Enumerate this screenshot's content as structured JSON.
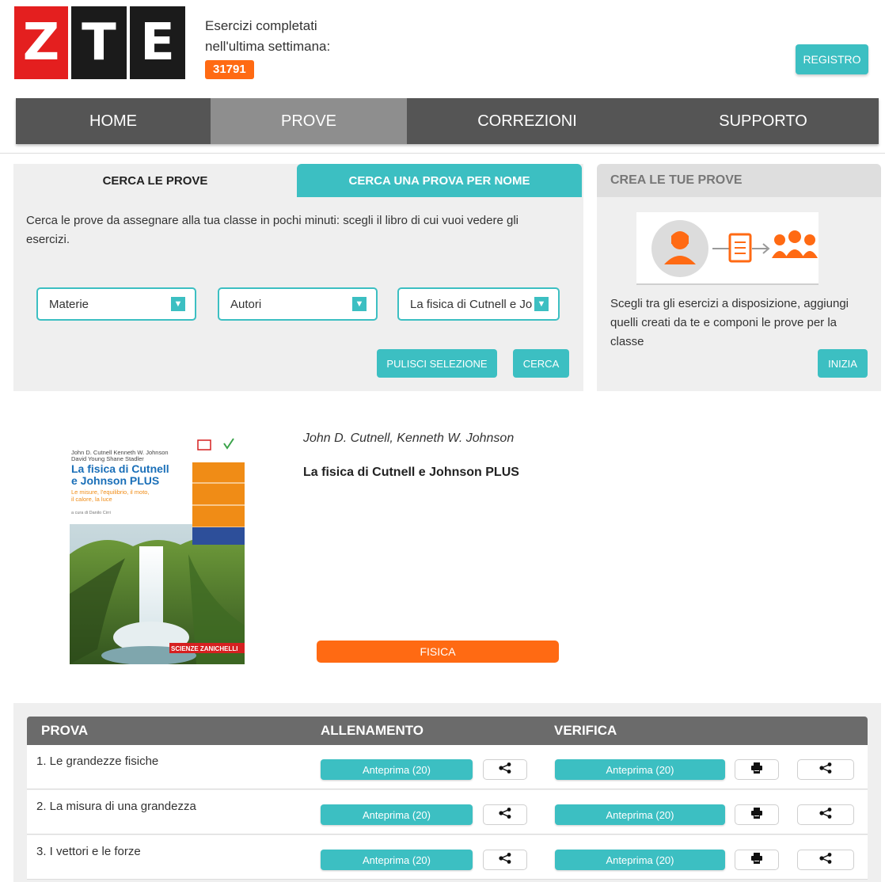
{
  "header": {
    "logo_letters": [
      "Z",
      "T",
      "E"
    ],
    "stats_line1": "Esercizi completati",
    "stats_line2": "nell'ultima settimana:",
    "stats_count": "31791",
    "registro": "REGISTRO"
  },
  "nav": [
    {
      "label": "HOME",
      "active": false
    },
    {
      "label": "PROVE",
      "active": true
    },
    {
      "label": "CORREZIONI",
      "active": false
    },
    {
      "label": "SUPPORTO",
      "active": false
    }
  ],
  "search": {
    "tab1": "CERCA LE PROVE",
    "tab2": "CERCA UNA PROVA PER NOME",
    "description": "Cerca le prove da assegnare alla tua classe in pochi minuti: scegli il libro di cui vuoi vedere gli esercizi.",
    "selects": [
      "Materie",
      "Autori",
      "La fisica di Cutnell e Johnson PLUS"
    ],
    "pulisci": "PULISCI SELEZIONE",
    "cerca": "CERCA"
  },
  "create": {
    "title": "CREA LE TUE PROVE",
    "description": "Scegli tra gli esercizi a disposizione, aggiungi quelli creati da te e componi le prove per la classe",
    "inizia": "INIZIA"
  },
  "book": {
    "authors": "John D. Cutnell, Kenneth W. Johnson",
    "title": "La fisica di Cutnell e Johnson PLUS",
    "subject_button": "FISICA",
    "cover": {
      "authors_line1": "John D. Cutnell  Kenneth W. Johnson",
      "authors_line2": "David Young  Shane Stadler",
      "title_line1": "La fisica di Cutnell",
      "title_line2": "e Johnson PLUS",
      "subtitle_line1": "Le misure, l'equilibrio, il moto,",
      "subtitle_line2": "il calore, la luce",
      "curator": "a cura di Danilo Cirri",
      "publisher": "SCIENZE  ZANICHELLI"
    }
  },
  "table": {
    "headers": {
      "prova": "PROVA",
      "allenamento": "ALLENAMENTO",
      "verifica": "VERIFICA"
    },
    "rows": [
      {
        "label": "1. Le grandezze fisiche",
        "allenamento": "Anteprima (20)",
        "verifica": "Anteprima (20)"
      },
      {
        "label": "2. La misura di una grandezza",
        "allenamento": "Anteprima (20)",
        "verifica": "Anteprima (20)"
      },
      {
        "label": "3. I vettori e le forze",
        "allenamento": "Anteprima (20)",
        "verifica": "Anteprima (20)"
      }
    ]
  },
  "colors": {
    "teal": "#3cbfc2",
    "orange": "#ff6a13",
    "nav": "#555555",
    "nav_active": "#8e8e8e",
    "logo_red": "#e41f1f"
  },
  "icons": {
    "share": "share-icon",
    "print": "print-icon",
    "dropdown": "chevron-down-icon"
  }
}
